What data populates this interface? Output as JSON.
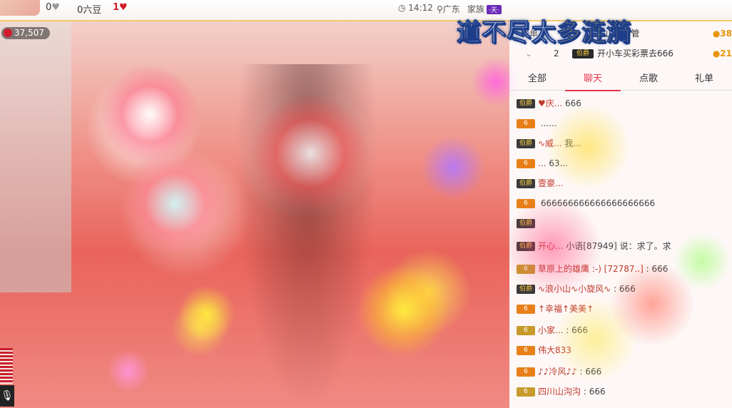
{
  "topbar": {
    "hearts": "0",
    "liudou": "0六豆",
    "likes": "1",
    "time": "14:12",
    "location": "广东",
    "family_label": "家族",
    "family_badge": "·天·"
  },
  "stage": {
    "viewer_count": "37,507"
  },
  "banner": {
    "text_a": "道不尽太",
    "text_b": "多涟漪"
  },
  "ranking": {
    "label": "榜单",
    "rows": [
      {
        "no": "",
        "badge": "",
        "text": "...山也不管",
        "score": "38"
      },
      {
        "no": "2",
        "badge": "伯爵",
        "text": "开小车买彩票去666",
        "score": "21"
      }
    ]
  },
  "tabs": [
    "全部",
    "聊天",
    "点歌",
    "礼单"
  ],
  "active_tab": "聊天",
  "chat": [
    {
      "lv": "伯爵",
      "lvclass": "dark",
      "nick": "♥庆...",
      "text": "666"
    },
    {
      "lv": "6",
      "lvclass": "orange",
      "nick": "",
      "text": "......"
    },
    {
      "lv": "伯爵",
      "lvclass": "dark",
      "nick": "∿威...",
      "text": "我..."
    },
    {
      "lv": "6",
      "lvclass": "orange",
      "nick": "...",
      "text": "63..."
    },
    {
      "lv": "伯爵",
      "lvclass": "dark",
      "nick": "壹豪...",
      "text": ""
    },
    {
      "lv": "6",
      "lvclass": "orange",
      "nick": "",
      "text": "666666666666666666666"
    },
    {
      "lv": "伯爵",
      "lvclass": "dark",
      "nick": "",
      "text": ""
    },
    {
      "lv": "伯爵",
      "lvclass": "dark",
      "nick": "开心...",
      "text": "小语[87949] 说：求了。求"
    },
    {
      "lv": "6",
      "lvclass": "gold",
      "nick": "草原上的雄鹰 :-) [72787..]",
      "text": "666"
    },
    {
      "lv": "伯爵",
      "lvclass": "dark",
      "nick": "∿浪小山∿小旋风∿",
      "text": "666"
    },
    {
      "lv": "6",
      "lvclass": "orange",
      "nick": "↑幸福↑美美↑",
      "text": ""
    },
    {
      "lv": "6",
      "lvclass": "gold",
      "nick": "小家...",
      "text": "666"
    },
    {
      "lv": "6",
      "lvclass": "orange",
      "nick": "伟大833",
      "text": ""
    },
    {
      "lv": "6",
      "lvclass": "orange",
      "nick": "♪♪冷风♪♪",
      "text": "666"
    },
    {
      "lv": "6",
      "lvclass": "gold",
      "nick": "四川山沟沟",
      "text": "666"
    }
  ]
}
